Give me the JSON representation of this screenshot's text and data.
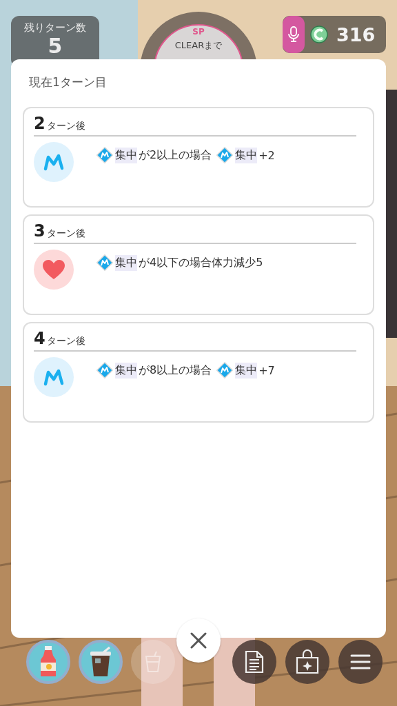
{
  "hud": {
    "turns_left": {
      "label": "残りターン数",
      "value": "5"
    },
    "goal": {
      "badge": "SP",
      "label": "CLEARまで"
    },
    "currency": {
      "value": "316"
    }
  },
  "panel": {
    "title": "現在1ターン目",
    "entries": [
      {
        "number": "2",
        "suffix": "ターン後",
        "kind": "focus",
        "effect": [
          {
            "kind": "icon"
          },
          {
            "kind": "keyword",
            "text": "集中"
          },
          {
            "kind": "text",
            "text": "が2以上の場合"
          },
          {
            "kind": "icon"
          },
          {
            "kind": "keyword",
            "text": "集中"
          },
          {
            "kind": "text",
            "text": "+2"
          }
        ]
      },
      {
        "number": "3",
        "suffix": "ターン後",
        "kind": "health",
        "effect": [
          {
            "kind": "icon"
          },
          {
            "kind": "keyword",
            "text": "集中"
          },
          {
            "kind": "text",
            "text": "が4以下の場合体力減少5"
          }
        ]
      },
      {
        "number": "4",
        "suffix": "ターン後",
        "kind": "focus",
        "effect": [
          {
            "kind": "icon"
          },
          {
            "kind": "keyword",
            "text": "集中"
          },
          {
            "kind": "text",
            "text": "が8以上の場合"
          },
          {
            "kind": "icon"
          },
          {
            "kind": "keyword",
            "text": "集中"
          },
          {
            "kind": "text",
            "text": "+7"
          }
        ]
      }
    ]
  },
  "bottom_bar": {
    "items": [
      {
        "kind": "bottle"
      },
      {
        "kind": "iced-coffee"
      },
      {
        "kind": "empty"
      }
    ],
    "actions": [
      {
        "kind": "memo"
      },
      {
        "kind": "shop"
      },
      {
        "kind": "menu"
      }
    ]
  }
}
